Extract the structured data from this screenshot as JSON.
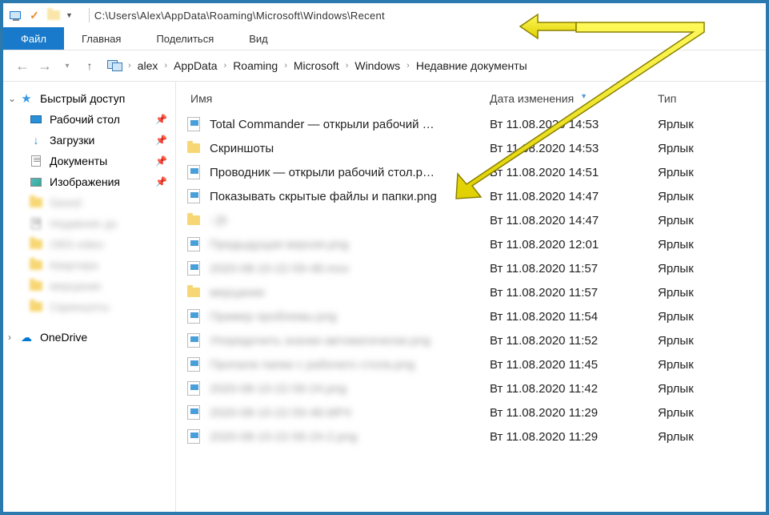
{
  "titlebar": {
    "path": "C:\\Users\\Alex\\AppData\\Roaming\\Microsoft\\Windows\\Recent"
  },
  "ribbon": {
    "tabs": [
      "Файл",
      "Главная",
      "Поделиться",
      "Вид"
    ]
  },
  "breadcrumb": {
    "items": [
      "alex",
      "AppData",
      "Roaming",
      "Microsoft",
      "Windows",
      "Недавние документы"
    ]
  },
  "sidebar": {
    "quick_access": "Быстрый доступ",
    "items": [
      {
        "label": "Рабочий стол",
        "icon": "desktop",
        "pinned": true
      },
      {
        "label": "Загрузки",
        "icon": "download",
        "pinned": true
      },
      {
        "label": "Документы",
        "icon": "doc",
        "pinned": true
      },
      {
        "label": "Изображения",
        "icon": "img",
        "pinned": true,
        "truncated": true
      },
      {
        "label": "Saved",
        "icon": "folder",
        "blurred": true
      },
      {
        "label": "Недавние до",
        "icon": "doc",
        "blurred": true
      },
      {
        "label": "OBS-video",
        "icon": "folder",
        "blurred": true
      },
      {
        "label": "Квартира",
        "icon": "folder",
        "blurred": true
      },
      {
        "label": "мерцание",
        "icon": "folder",
        "blurred": true
      },
      {
        "label": "Скриншоты",
        "icon": "folder",
        "blurred": true
      }
    ],
    "onedrive": "OneDrive"
  },
  "columns": {
    "name": "Имя",
    "date": "Дата изменения",
    "type": "Тип"
  },
  "files": [
    {
      "name": "Total Commander — открыли рабочий …",
      "date": "Вт 11.08.2020 14:53",
      "type": "Ярлык",
      "icon": "shortcut"
    },
    {
      "name": "Скриншоты",
      "date": "Вт 11.08.2020 14:53",
      "type": "Ярлык",
      "icon": "folder"
    },
    {
      "name": "Проводник — открыли рабочий стол.p…",
      "date": "Вт 11.08.2020 14:51",
      "type": "Ярлык",
      "icon": "shortcut"
    },
    {
      "name": "Показывать скрытые файлы и папки.png",
      "date": "Вт 11.08.2020 14:47",
      "type": "Ярлык",
      "icon": "shortcut"
    },
    {
      "name": "::{6",
      "date": "Вт 11.08.2020 14:47",
      "type": "Ярлык",
      "icon": "folder",
      "blurred": true
    },
    {
      "name": "Предыдущая версия.png",
      "date": "Вт 11.08.2020 12:01",
      "type": "Ярлык",
      "icon": "shortcut",
      "blurred": true
    },
    {
      "name": "2020-08-10-22-59-48.mov",
      "date": "Вт 11.08.2020 11:57",
      "type": "Ярлык",
      "icon": "shortcut-vid",
      "blurred": true
    },
    {
      "name": "мерцание",
      "date": "Вт 11.08.2020 11:57",
      "type": "Ярлык",
      "icon": "folder",
      "blurred": true
    },
    {
      "name": "Пример проблемы.png",
      "date": "Вт 11.08.2020 11:54",
      "type": "Ярлык",
      "icon": "shortcut",
      "blurred": true
    },
    {
      "name": "Упорядочить значки автоматически.png",
      "date": "Вт 11.08.2020 11:52",
      "type": "Ярлык",
      "icon": "shortcut",
      "blurred": true
    },
    {
      "name": "Пропали папки с рабочего стола.png",
      "date": "Вт 11.08.2020 11:45",
      "type": "Ярлык",
      "icon": "shortcut",
      "blurred": true
    },
    {
      "name": "2020-08-10-22-56-24.png",
      "date": "Вт 11.08.2020 11:42",
      "type": "Ярлык",
      "icon": "shortcut",
      "blurred": true
    },
    {
      "name": "2020-08-10-22-59-48.MP4",
      "date": "Вт 11.08.2020 11:29",
      "type": "Ярлык",
      "icon": "shortcut-vid",
      "blurred": true
    },
    {
      "name": "2020-08-10-22-56-24-2.png",
      "date": "Вт 11.08.2020 11:29",
      "type": "Ярлык",
      "icon": "shortcut",
      "blurred": true
    }
  ]
}
